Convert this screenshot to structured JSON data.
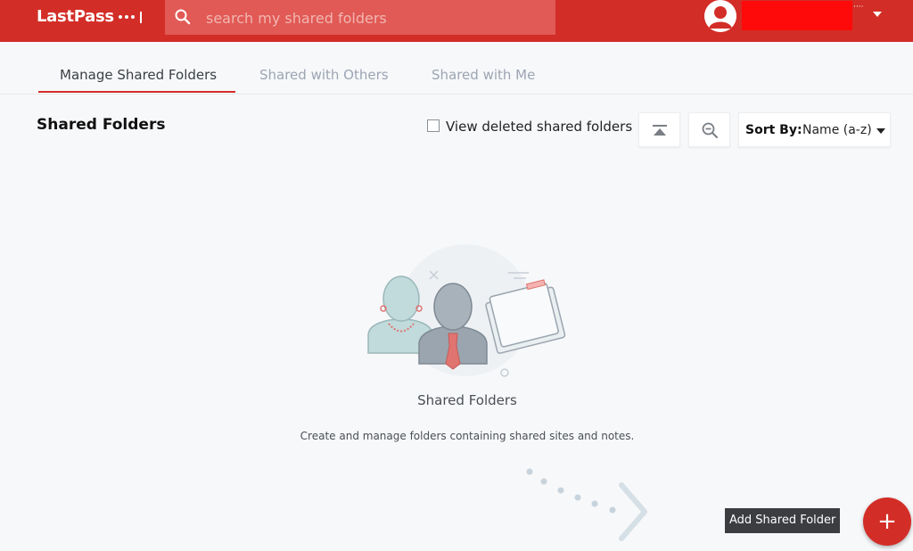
{
  "header": {
    "logo_text": "LastPass",
    "search_placeholder": "search my shared folders",
    "user_dots": "····"
  },
  "tabs": [
    {
      "label": "Manage Shared Folders",
      "active": true
    },
    {
      "label": "Shared with Others",
      "active": false
    },
    {
      "label": "Shared with Me",
      "active": false
    }
  ],
  "toolbar": {
    "title": "Shared Folders",
    "view_deleted_label": "View deleted shared folders",
    "view_deleted_checked": false,
    "sort_label": "Sort By:",
    "sort_value": "Name (a-z)"
  },
  "empty_state": {
    "title": "Shared Folders",
    "description": "Create and manage folders containing shared sites and notes."
  },
  "fab": {
    "tooltip": "Add Shared Folder",
    "icon": "+"
  },
  "colors": {
    "brand": "#d32d27",
    "background": "#f7f8fa"
  },
  "icons": [
    "search-icon",
    "avatar-icon",
    "chevron-down-icon",
    "collapse-top-icon",
    "zoom-out-icon",
    "plus-icon"
  ]
}
